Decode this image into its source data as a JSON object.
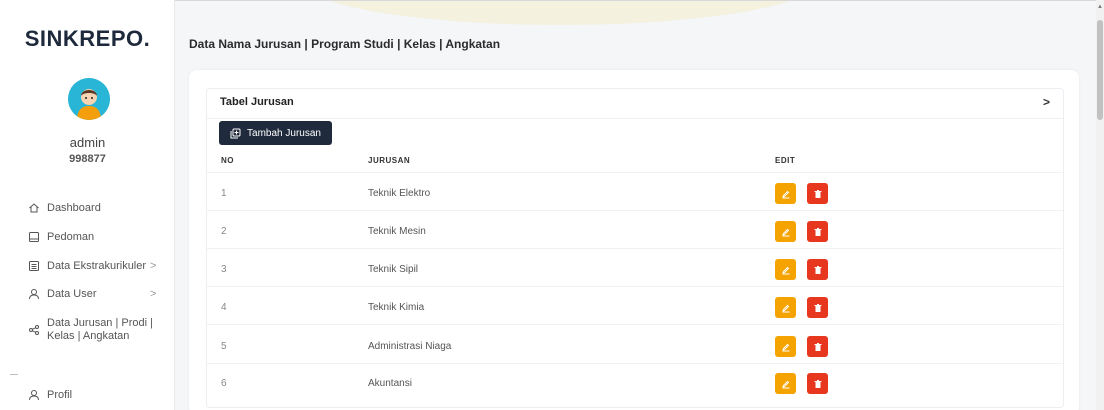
{
  "brand": "SINKREPO.",
  "user": {
    "name": "admin",
    "id": "998877"
  },
  "nav": [
    {
      "label": "Dashboard",
      "icon": "home-icon"
    },
    {
      "label": "Pedoman",
      "icon": "book-icon"
    },
    {
      "label": "Data Ekstrakurikuler",
      "icon": "list-icon",
      "chevron": ">"
    },
    {
      "label": "Data User",
      "icon": "user-icon",
      "chevron": ">"
    },
    {
      "label_line1": "Data Jurusan | Prodi |",
      "label_line2": "Kelas | Angkatan",
      "icon": "share-icon"
    },
    {
      "label": "Profil",
      "icon": "user-icon"
    }
  ],
  "breadcrumb": "Data Nama Jurusan | Program Studi | Kelas | Angkatan",
  "card": {
    "title": "Tabel Jurusan",
    "chevron": ">",
    "add_button": "Tambah Jurusan"
  },
  "table": {
    "headers": [
      "NO",
      "JURUSAN",
      "EDIT"
    ],
    "rows": [
      {
        "no": "1",
        "jurusan": "Teknik Elektro"
      },
      {
        "no": "2",
        "jurusan": "Teknik Mesin"
      },
      {
        "no": "3",
        "jurusan": "Teknik Sipil"
      },
      {
        "no": "4",
        "jurusan": "Teknik Kimia"
      },
      {
        "no": "5",
        "jurusan": "Administrasi Niaga"
      },
      {
        "no": "6",
        "jurusan": "Akuntansi"
      }
    ]
  },
  "colors": {
    "primary_dark": "#1f2a3c",
    "edit": "#f5a300",
    "delete": "#e8371f",
    "avatar_bg": "#29b6d6"
  }
}
